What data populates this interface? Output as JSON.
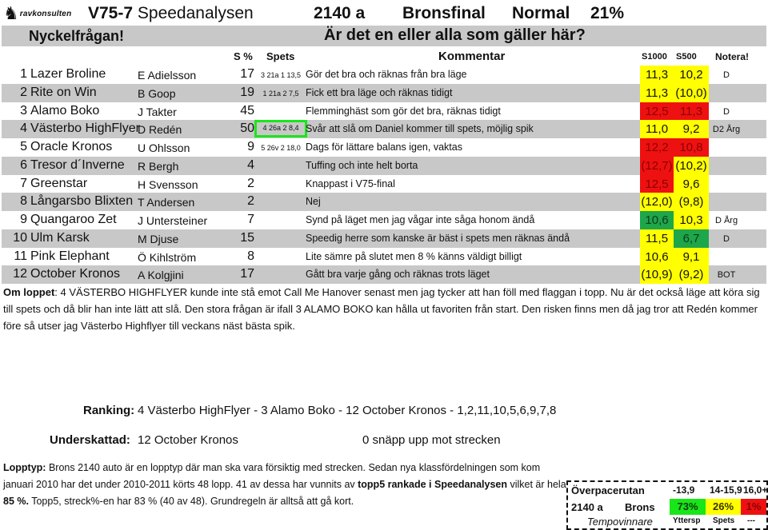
{
  "header": {
    "logo_text": "ravkonsulten",
    "race": "V75-7",
    "title": "Speedanalysen",
    "distance": "2140 a",
    "class": "Bronsfinal",
    "tempo": "Normal",
    "percent": "21%"
  },
  "banner": {
    "label": "Nyckelfrågan!",
    "question": "Är det en eller alla som gäller här?"
  },
  "columns": {
    "s_pct": "S %",
    "spets": "Spets",
    "comment": "Kommentar",
    "s1000": "S1000",
    "s500": "S500",
    "note": "Notera!"
  },
  "horses": [
    {
      "num": "1",
      "name": "Lazer Broline",
      "driver": "E Adielsson",
      "s_pct": "17",
      "spets": "3 21a 1 13,5",
      "comment": "Gör det bra och räknas från bra läge",
      "s1000": "11,3",
      "s1000_color": "yellow",
      "s500": "10,2",
      "s500_color": "yellow",
      "note": "D"
    },
    {
      "num": "2",
      "name": "Rite on Win",
      "driver": "B Goop",
      "s_pct": "19",
      "spets": "1 21a 2  7,5",
      "comment": "Fick ett bra läge och räknas tidigt",
      "s1000": "11,3",
      "s1000_color": "yellow",
      "s500": "(10,0)",
      "s500_color": "yellow",
      "note": ""
    },
    {
      "num": "3",
      "name": "Alamo Boko",
      "driver": "J Takter",
      "s_pct": "45",
      "spets": "",
      "comment": "Flemminghäst som gör det bra, räknas tidigt",
      "s1000": "12,5",
      "s1000_color": "red",
      "s500": "11,3",
      "s500_color": "red",
      "note": "D"
    },
    {
      "num": "4",
      "name": "Västerbo HighFlyer",
      "driver": "D Redén",
      "s_pct": "50",
      "spets": "4 26a 2  8,4",
      "spets_highlight": true,
      "comment": "Svår att slå om Daniel kommer till spets, möjlig spik",
      "s1000": "11,0",
      "s1000_color": "yellow",
      "s500": "9,2",
      "s500_color": "yellow",
      "note": "D2 Årg"
    },
    {
      "num": "5",
      "name": "Oracle Kronos",
      "driver": "U Ohlsson",
      "s_pct": "9",
      "spets": "5 26v 2 18,0",
      "comment": "Dags för lättare balans igen, vaktas",
      "s1000": "12,2",
      "s1000_color": "red",
      "s500": "10,8",
      "s500_color": "red",
      "note": ""
    },
    {
      "num": "6",
      "name": "Tresor d´Inverne",
      "driver": "R Bergh",
      "s_pct": "4",
      "spets": "",
      "comment": "Tuffing och inte helt borta",
      "s1000": "(12,7)",
      "s1000_color": "red",
      "s500": "(10,2)",
      "s500_color": "yellow",
      "note": ""
    },
    {
      "num": "7",
      "name": "Greenstar",
      "driver": "H Svensson",
      "s_pct": "2",
      "spets": "",
      "comment": "Knappast i V75-final",
      "s1000": "12,5",
      "s1000_color": "red",
      "s500": "9,6",
      "s500_color": "yellow",
      "note": ""
    },
    {
      "num": "8",
      "name": "Långarsbo Blixten",
      "driver": "T Andersen",
      "s_pct": "2",
      "spets": "",
      "comment": "Nej",
      "s1000": "(12,0)",
      "s1000_color": "yellow",
      "s500": "(9,8)",
      "s500_color": "yellow",
      "note": ""
    },
    {
      "num": "9",
      "name": "Quangaroo Zet",
      "driver": "J Untersteiner",
      "s_pct": "7",
      "spets": "",
      "comment": "Synd på läget men jag vågar inte såga honom ändå",
      "s1000": "10,6",
      "s1000_color": "green",
      "s500": "10,3",
      "s500_color": "yellow",
      "note": "D Årg"
    },
    {
      "num": "10",
      "name": "Ulm Karsk",
      "driver": "M Djuse",
      "s_pct": "15",
      "spets": "",
      "comment": "Speedig herre som kanske är bäst i spets men räknas ändå",
      "s1000": "11,5",
      "s1000_color": "yellow",
      "s500": "6,7",
      "s500_color": "green",
      "note": "D"
    },
    {
      "num": "11",
      "name": "Pink Elephant",
      "driver": "Ö Kihlström",
      "s_pct": "8",
      "spets": "",
      "comment": "Lite sämre på slutet men 8 % känns väldigt billigt",
      "s1000": "10,6",
      "s1000_color": "yellow",
      "s500": "9,1",
      "s500_color": "yellow",
      "note": ""
    },
    {
      "num": "12",
      "name": "October Kronos",
      "driver": "A Kolgjini",
      "s_pct": "17",
      "spets": "",
      "comment": "Gått bra varje gång och räknas trots läget",
      "s1000": "(10,9)",
      "s1000_color": "yellow",
      "s500": "(9,2)",
      "s500_color": "yellow",
      "note": "BOT"
    }
  ],
  "om_loppet": {
    "label": "Om loppet",
    "text": ": 4 VÄSTERBO HIGHFLYER kunde inte stå emot Call Me Hanover senast men jag tycker att han föll med flaggan i topp. Nu är det också läge att köra sig till spets och då blir han inte lätt att slå. Den stora frågan är ifall 3 ALAMO BOKO kan hålla ut favoriten från start. Den risken finns men då jag tror att Redén kommer före så utser jag Västerbo Highflyer till veckans näst bästa spik."
  },
  "ranking": {
    "label": "Ranking:",
    "value": "4 Västerbo HighFlyer - 3 Alamo Boko - 12 October Kronos - 1,2,11,10,5,6,9,7,8"
  },
  "underskattad": {
    "label": "Underskattad:",
    "value": "12 October Kronos",
    "note": "0 snäpp upp mot strecken"
  },
  "lopptyp": {
    "label": "Lopptyp:",
    "text1": " Brons 2140 auto är en lopptyp där man ska vara försiktig med strecken. Sedan nya klassfördelningen som kom januari 2010 har det under 2010-2011 körts 48 lopp. 41 av dessa har vunnits av ",
    "bold1": "topp5 rankade i Speedanalysen",
    "text2": " vilket är hela ",
    "bold2": "85 %.",
    "text3": " Topp5, streck%-en har 83 % (40 av 48). Grundregeln är alltså att gå kort."
  },
  "overpace": {
    "title": "Överpacerutan",
    "col1": "-13,9",
    "col2": "14-15,9",
    "col3": "16,0+",
    "distance": "2140 a",
    "class": "Brons",
    "v1": "73%",
    "v2": "26%",
    "v3": "1%",
    "row3_label": "Tempovinnare",
    "l1": "Yttersp",
    "l2": "Spets",
    "l3": "---"
  },
  "colors": {
    "yellow": "#ffff00",
    "red": "#ee1111",
    "green": "#1ea64a",
    "highlight_green": "#19e619",
    "row_gray": "#c8c8c8"
  }
}
